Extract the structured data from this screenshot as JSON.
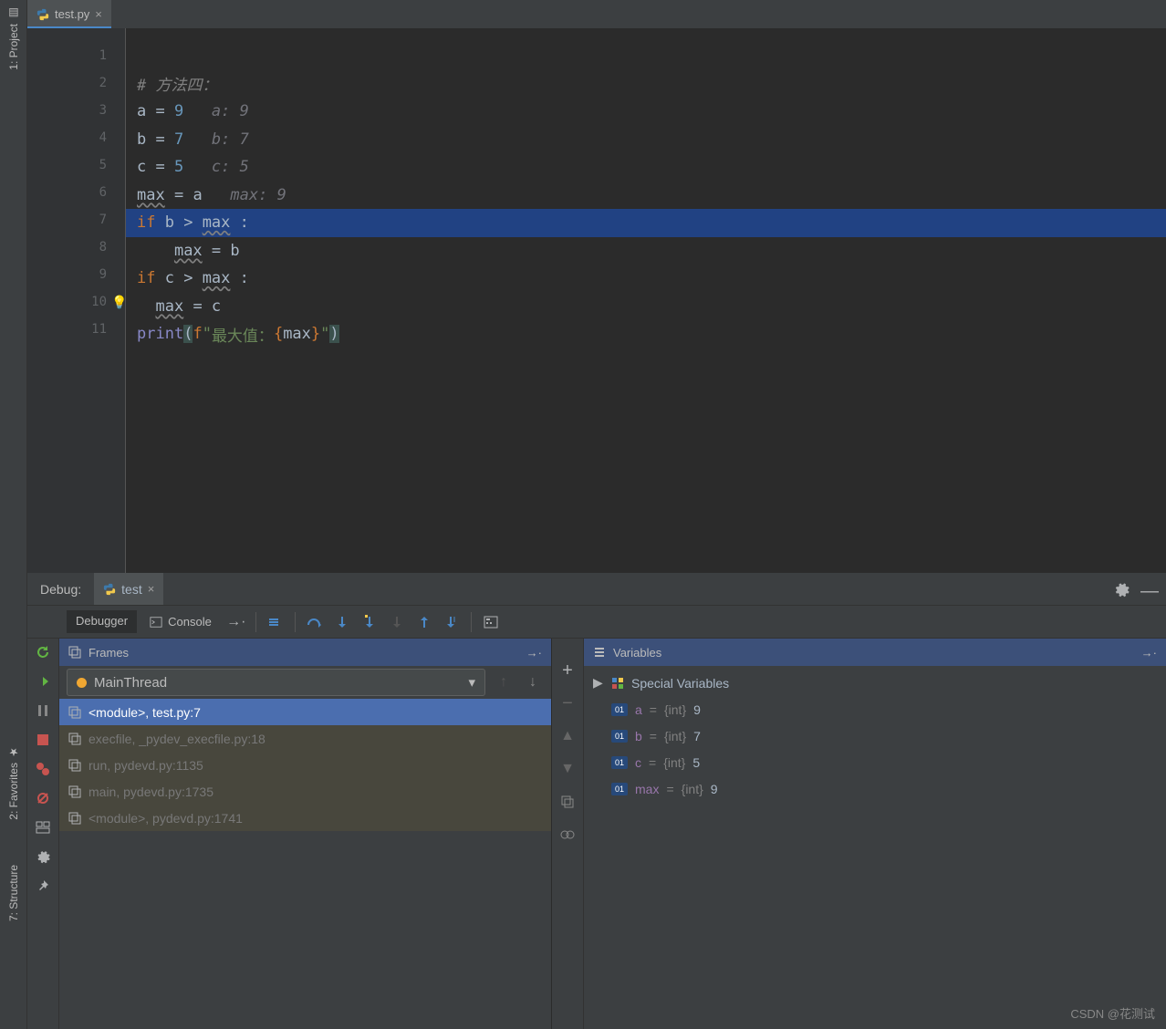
{
  "left_gutter": {
    "project": "1: Project",
    "favorites": "2: Favorites",
    "structure": "7: Structure"
  },
  "editor": {
    "tab": {
      "filename": "test.py"
    },
    "lines": [
      "1",
      "2",
      "3",
      "4",
      "5",
      "6",
      "7",
      "8",
      "9",
      "10",
      "11"
    ],
    "breakpoint_line": "7",
    "code": {
      "l2_comment": "# 方法四：",
      "l3": {
        "a": "a",
        "eq": " = ",
        "num": "9",
        "hint": "   a: 9"
      },
      "l4": {
        "b": "b",
        "eq": " = ",
        "num": "7",
        "hint": "   b: 7"
      },
      "l5": {
        "c": "c",
        "eq": " = ",
        "num": "5",
        "hint": "   c: 5"
      },
      "l6": {
        "max": "max",
        "eq": " = ",
        "a": "a",
        "hint": "   max: 9"
      },
      "l7": {
        "if": "if ",
        "b": "b",
        "gt": " > ",
        "max": "max",
        "tail": " :"
      },
      "l8": {
        "indent": "    ",
        "max": "max",
        "eq": " = ",
        "b": "b"
      },
      "l9": {
        "if": "if ",
        "c": "c",
        "gt": " > ",
        "max": "max",
        "tail": " :"
      },
      "l10": {
        "indent": "  ",
        "max": "max",
        "eq": " = ",
        "c": "c"
      },
      "l11": {
        "print": "print",
        "lp": "(",
        "f": "f",
        "q1": "\"",
        "str1": "最大值：",
        "lb": "{",
        "max": "max",
        "rb": "}",
        "q2": "\"",
        "rp": ")"
      }
    }
  },
  "debug": {
    "label": "Debug:",
    "tab": "test",
    "debugger_tab": "Debugger",
    "console_tab": "Console",
    "frames_label": "Frames",
    "variables_label": "Variables",
    "thread": "MainThread",
    "frames": [
      {
        "text": "<module>, test.py:7",
        "selected": true
      },
      {
        "text": "execfile, _pydev_execfile.py:18",
        "dim": true
      },
      {
        "text": "run, pydevd.py:1135",
        "dim": true
      },
      {
        "text": "main, pydevd.py:1735",
        "dim": true
      },
      {
        "text": "<module>, pydevd.py:1741",
        "dim": true
      }
    ],
    "special_vars": "Special Variables",
    "vars": [
      {
        "name": "a",
        "type": "{int}",
        "val": "9"
      },
      {
        "name": "b",
        "type": "{int}",
        "val": "7"
      },
      {
        "name": "c",
        "type": "{int}",
        "val": "5"
      },
      {
        "name": "max",
        "type": "{int}",
        "val": "9"
      }
    ]
  },
  "watermark": "CSDN @花测试"
}
